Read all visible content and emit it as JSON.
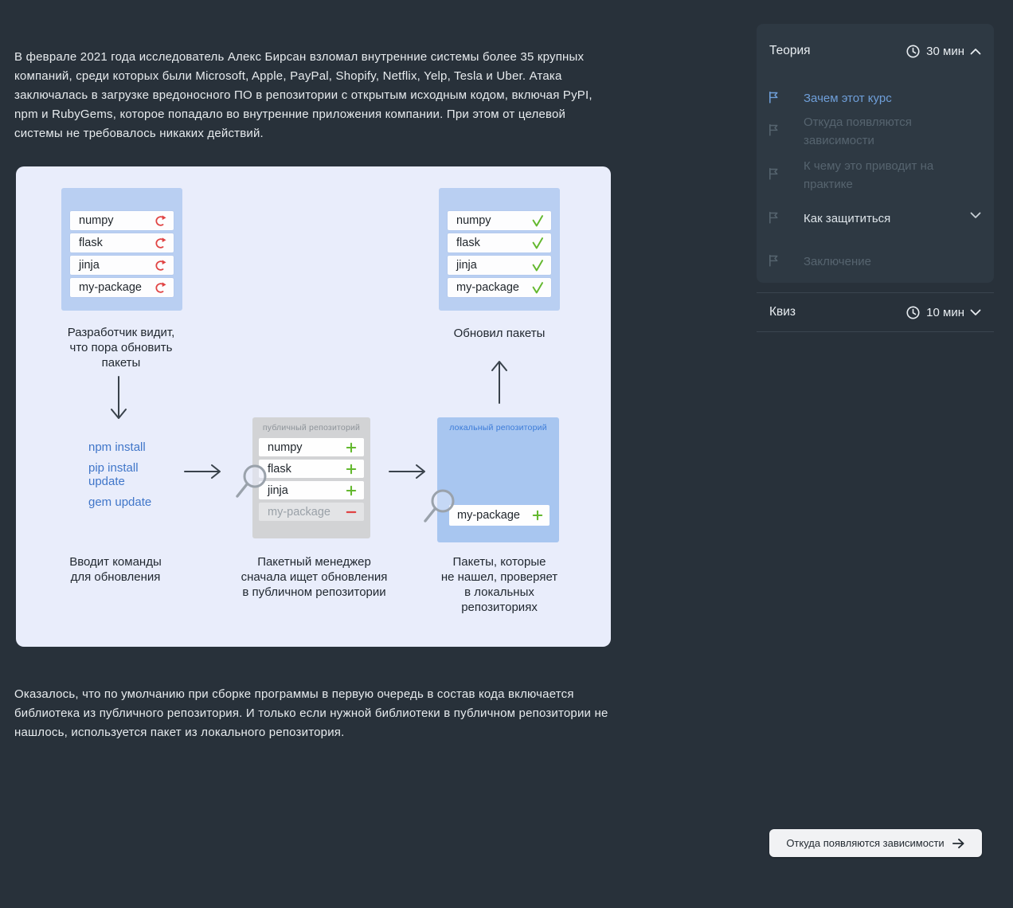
{
  "colors": {
    "background": "#28313a",
    "panel_light": "#e9edfb",
    "box_blue": "#b9cff2",
    "box_blue_dark": "#a8c6f0",
    "box_gray": "#d2d3d5",
    "accent_blue": "#4076c9",
    "active_item_blue": "#6f9fd9",
    "green": "#63b82e",
    "red": "#e04343",
    "button_bg": "#f1f2f4"
  },
  "content": {
    "intro": "В феврале 2021 года исследователь Алекс Бирсан взломал внутренние системы более 35 крупных компаний, среди которых были Microsoft, Apple, PayPal, Shopify, Netflix, Yelp, Tesla и Uber. Атака заключалась в загрузке вредоносного ПО в репозитории с открытым исходным кодом, включая PyPI, npm и RubyGems, которое попадало во внутренние приложения компании. При этом от целевой системы не требовалось никаких действий.",
    "outro": "Оказалось, что по умолчанию при сборке программы в первую очередь в состав кода включается библиотека из публичного репозитория. И только если нужной библиотеки в публичном репозитории не нашлось, используется пакет из локального репозитория."
  },
  "diagram": {
    "dev_box": {
      "packages": [
        "numpy",
        "flask",
        "jinja",
        "my-package"
      ]
    },
    "updated_box": {
      "packages": [
        "numpy",
        "flask",
        "jinja",
        "my-package"
      ]
    },
    "commands": [
      "npm install",
      "pip install update",
      "gem update"
    ],
    "public_repo": {
      "title": "публичный репозиторий",
      "rows": [
        "numpy",
        "flask",
        "jinja"
      ],
      "missing": "my-package"
    },
    "local_repo": {
      "title": "локальный репозиторий",
      "found": "my-package"
    },
    "captions": {
      "developer": "Разработчик видит,\nчто пора обновить\nпакеты",
      "commands": "Вводит команды\nдля обновления",
      "public": "Пакетный менеджер\nсначала ищет обновления\nв публичном репозитории",
      "local": "Пакеты, которые\nне нашел, проверяет\nв локальных\nрепозиториях",
      "updated": "Обновил пакеты"
    }
  },
  "sidebar": {
    "theory": {
      "title": "Теория",
      "duration": "30 мин",
      "items": [
        {
          "label": "Зачем этот курс",
          "state": "active"
        },
        {
          "label": "Откуда появляются зависимости",
          "state": "locked"
        },
        {
          "label": "К чему это приводит на практике",
          "state": "locked"
        },
        {
          "label": "Как защититься",
          "state": "done"
        },
        {
          "label": "Заключение",
          "state": "locked"
        }
      ]
    },
    "quiz": {
      "title": "Квиз",
      "duration": "10 мин"
    }
  },
  "next_button": {
    "label": "Откуда появляются зависимости"
  }
}
